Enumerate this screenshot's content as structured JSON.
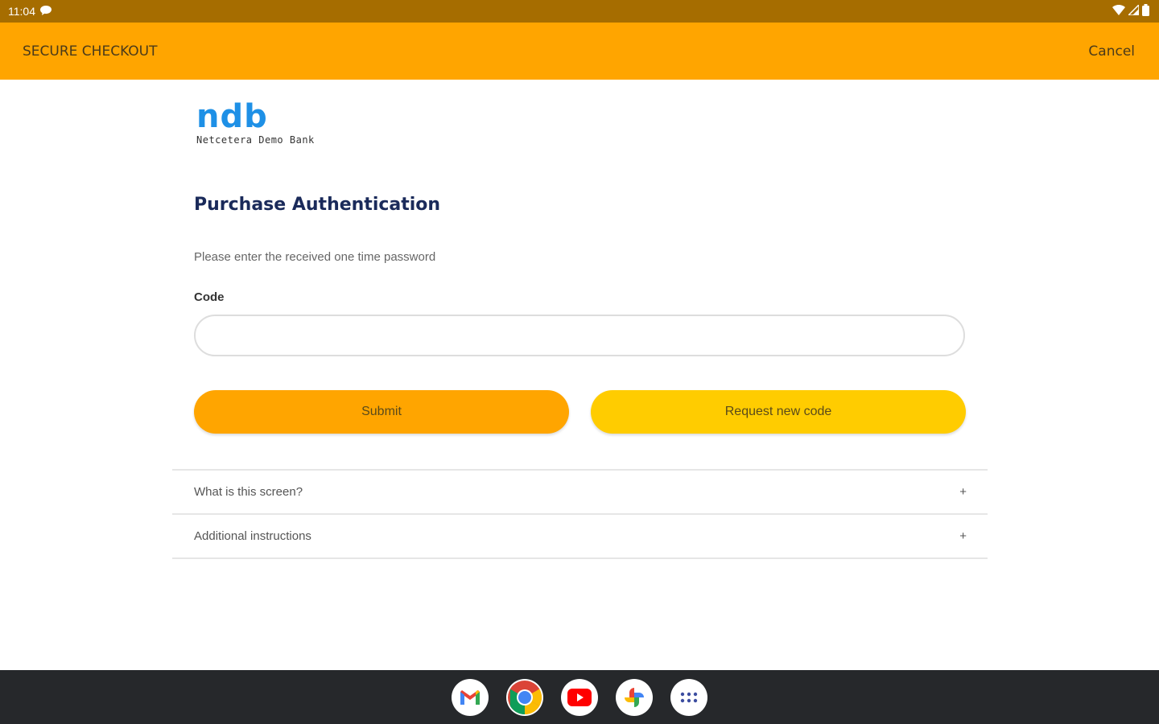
{
  "status_bar": {
    "time": "11:04"
  },
  "app_bar": {
    "title": "SECURE CHECKOUT",
    "cancel_label": "Cancel"
  },
  "bank": {
    "logo_text": "ndb",
    "name": "Netcetera Demo Bank"
  },
  "page": {
    "heading": "Purchase Authentication",
    "instruction": "Please enter the received one time password",
    "code_label": "Code",
    "code_value": ""
  },
  "buttons": {
    "submit": "Submit",
    "request_new_code": "Request new code"
  },
  "accordion": [
    {
      "label": "What is this screen?",
      "toggle": "+"
    },
    {
      "label": "Additional instructions",
      "toggle": "+"
    }
  ],
  "dock": [
    "gmail-icon",
    "chrome-icon",
    "youtube-icon",
    "photos-icon",
    "app-drawer-icon"
  ],
  "colors": {
    "status_bar": "#a66d00",
    "app_bar": "#ffa500",
    "submit": "#ffa500",
    "request": "#ffcc00",
    "logo": "#1e90e6",
    "heading": "#1a2a5a"
  }
}
